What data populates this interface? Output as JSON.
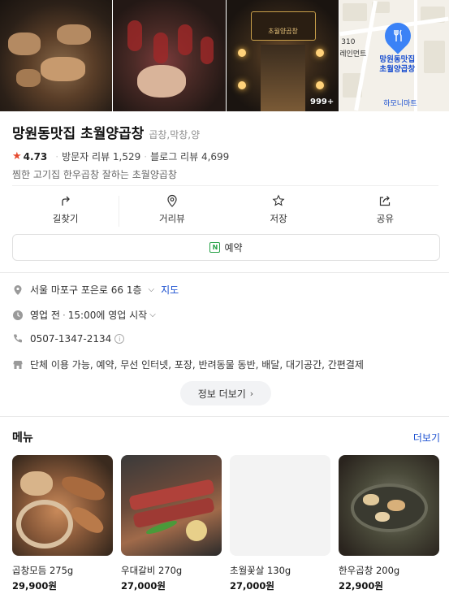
{
  "photos": {
    "count_badge": "999+",
    "store_sign": "초월양곱창",
    "map": {
      "place_label_line1": "망원동맛집",
      "place_label_line2": "초월양곱창",
      "nearby_label": "하모니마트",
      "left_text1": "310",
      "left_text2": "레인먼트"
    }
  },
  "place": {
    "name": "망원동맛집 초월양곱창",
    "category": "곱창,막창,양",
    "rating": "4.73",
    "visitor_reviews": "방문자 리뷰 1,529",
    "blog_reviews": "블로그 리뷰 4,699",
    "description": "찜한 고기집 한우곱창 잘하는 초월양곱창"
  },
  "actions": [
    {
      "label": "길찾기",
      "icon": "directions-icon"
    },
    {
      "label": "거리뷰",
      "icon": "location-pin-icon"
    },
    {
      "label": "저장",
      "icon": "star-icon"
    },
    {
      "label": "공유",
      "icon": "share-icon"
    }
  ],
  "reserve_label": "예약",
  "info": {
    "address": "서울 마포구 포은로 66 1층",
    "map_link": "지도",
    "hours_status": "영업 전",
    "hours_detail": "15:00에 영업 시작",
    "phone": "0507-1347-2134",
    "amenities": "단체 이용 가능, 예약, 무선 인터넷, 포장, 반려동물 동반, 배달, 대기공간, 간편결제",
    "more_label": "정보 더보기"
  },
  "menu": {
    "title": "메뉴",
    "more_label": "더보기",
    "items": [
      {
        "name": "곱창모듬 275g",
        "price": "29,900원"
      },
      {
        "name": "우대갈비 270g",
        "price": "27,000원"
      },
      {
        "name": "초월꽃살 130g",
        "price": "27,000원"
      },
      {
        "name": "한우곱창 200g",
        "price": "22,900원"
      }
    ]
  },
  "colors": {
    "accent_link": "#1a4fd0",
    "star": "#e64a2f",
    "reserve_green": "#26a146"
  }
}
